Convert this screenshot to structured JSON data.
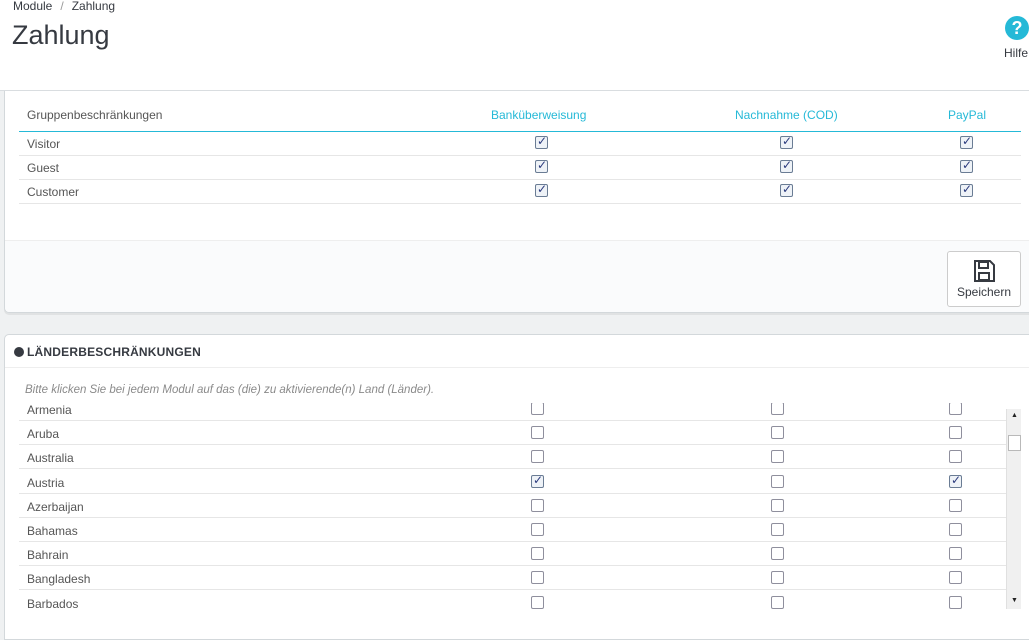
{
  "breadcrumb": {
    "module": "Module",
    "sep": "/",
    "current": "Zahlung"
  },
  "page_title": "Zahlung",
  "help": {
    "icon": "?",
    "label": "Hilfe"
  },
  "group_panel": {
    "header_label": "Gruppenbeschränkungen",
    "columns": [
      "Banküberweisung",
      "Nachnahme (COD)",
      "PayPal"
    ],
    "rows": [
      {
        "label": "Visitor",
        "checks": [
          true,
          true,
          true
        ]
      },
      {
        "label": "Guest",
        "checks": [
          true,
          true,
          true
        ]
      },
      {
        "label": "Customer",
        "checks": [
          true,
          true,
          true
        ]
      }
    ],
    "save_label": "Speichern"
  },
  "country_panel": {
    "title": "LÄNDERBESCHRÄNKUNGEN",
    "hint": "Bitte klicken Sie bei jedem Modul auf das (die) zu aktivierende(n) Land (Länder).",
    "rows": [
      {
        "label": "Armenia",
        "checks": [
          false,
          false,
          false
        ]
      },
      {
        "label": "Aruba",
        "checks": [
          false,
          false,
          false
        ]
      },
      {
        "label": "Australia",
        "checks": [
          false,
          false,
          false
        ]
      },
      {
        "label": "Austria",
        "checks": [
          true,
          false,
          true
        ]
      },
      {
        "label": "Azerbaijan",
        "checks": [
          false,
          false,
          false
        ]
      },
      {
        "label": "Bahamas",
        "checks": [
          false,
          false,
          false
        ]
      },
      {
        "label": "Bahrain",
        "checks": [
          false,
          false,
          false
        ]
      },
      {
        "label": "Bangladesh",
        "checks": [
          false,
          false,
          false
        ]
      },
      {
        "label": "Barbados",
        "checks": [
          false,
          false,
          false
        ]
      }
    ]
  },
  "colors": {
    "accent": "#25b9d7",
    "text": "#555555",
    "title": "#363a41"
  }
}
